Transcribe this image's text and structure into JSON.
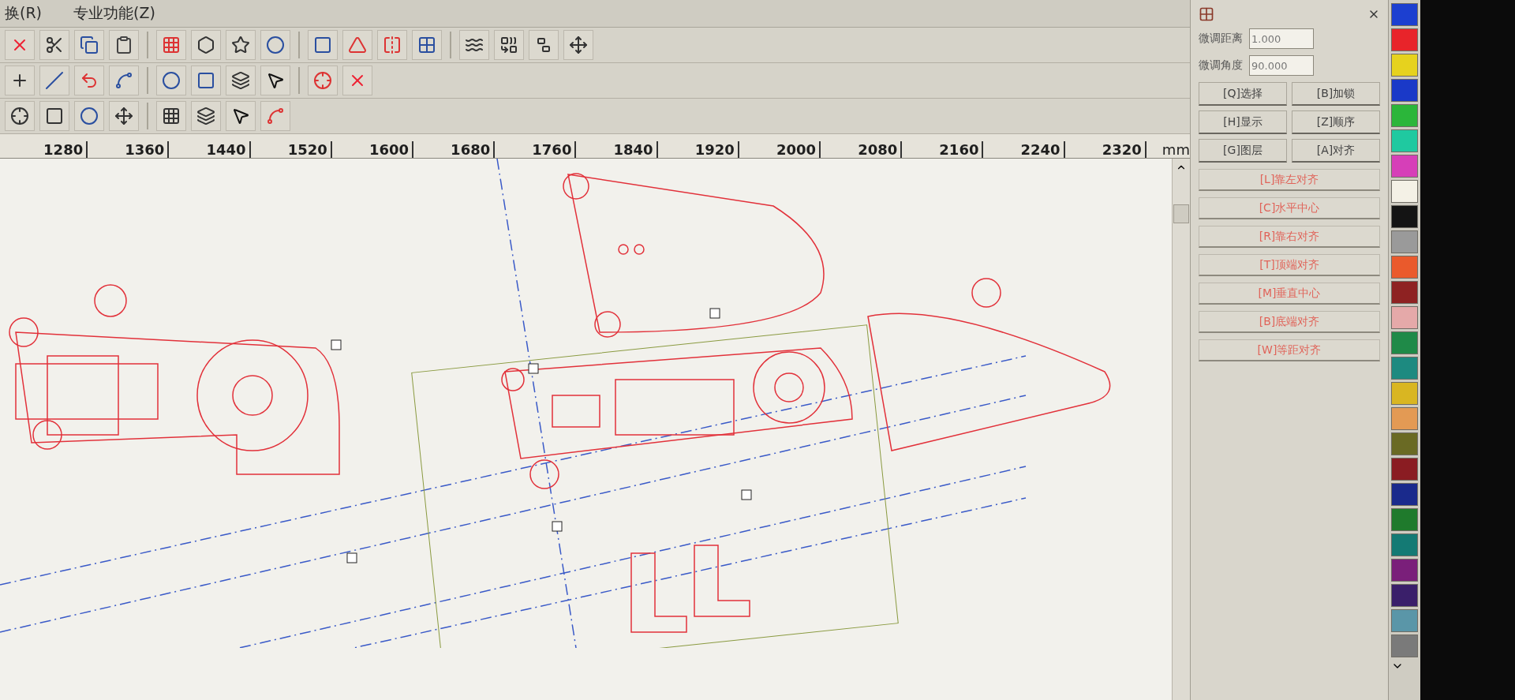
{
  "menu_bar": {
    "items": [
      {
        "label": "换(R)"
      },
      {
        "label": "专业功能(Z)"
      }
    ]
  },
  "ruler": {
    "ticks": [
      "1280",
      "1360",
      "1440",
      "1520",
      "1600",
      "1680",
      "1760",
      "1840",
      "1920",
      "2000",
      "2080",
      "2160",
      "2240",
      "2320"
    ],
    "unit": "mm"
  },
  "panel": {
    "fields": [
      {
        "label": "微调距离",
        "value": "1.000"
      },
      {
        "label": "微调角度",
        "value": "90.000"
      }
    ],
    "buttons": [
      {
        "label": "[Q]选择"
      },
      {
        "label": "[B]加锁"
      },
      {
        "label": "[H]显示"
      },
      {
        "label": "[Z]顺序"
      },
      {
        "label": "[G]图层"
      },
      {
        "label": "[A]对齐"
      }
    ],
    "align_buttons": [
      {
        "label": "[L]靠左对齐"
      },
      {
        "label": "[C]水平中心"
      },
      {
        "label": "[R]靠右对齐"
      },
      {
        "label": "[T]顶端对齐"
      },
      {
        "label": "[M]垂直中心"
      },
      {
        "label": "[B]底端对齐"
      },
      {
        "label": "[W]等距对齐"
      }
    ]
  },
  "palette": [
    {
      "color": "#1c3fd0"
    },
    {
      "color": "#e8242a"
    },
    {
      "color": "#e6d21e"
    },
    {
      "color": "#1a39c8"
    },
    {
      "color": "#2bb63a"
    },
    {
      "color": "#1fc9a0"
    },
    {
      "color": "#d63fb8"
    },
    {
      "color": "#f4f1e6"
    },
    {
      "color": "#141414"
    },
    {
      "color": "#9a9a9a"
    },
    {
      "color": "#ea5a2c"
    },
    {
      "color": "#8e2222"
    },
    {
      "color": "#e5a9a9"
    },
    {
      "color": "#1f8a48"
    },
    {
      "color": "#1d8a80"
    },
    {
      "color": "#d9b622"
    },
    {
      "color": "#e39a54"
    },
    {
      "color": "#6a6a24"
    },
    {
      "color": "#8a1c22"
    },
    {
      "color": "#1a2a8c"
    },
    {
      "color": "#1f7a2c"
    },
    {
      "color": "#147a74"
    },
    {
      "color": "#7a1f7a"
    },
    {
      "color": "#3a1f6a"
    },
    {
      "color": "#5a96a8"
    },
    {
      "color": "#7a7a7a"
    }
  ]
}
